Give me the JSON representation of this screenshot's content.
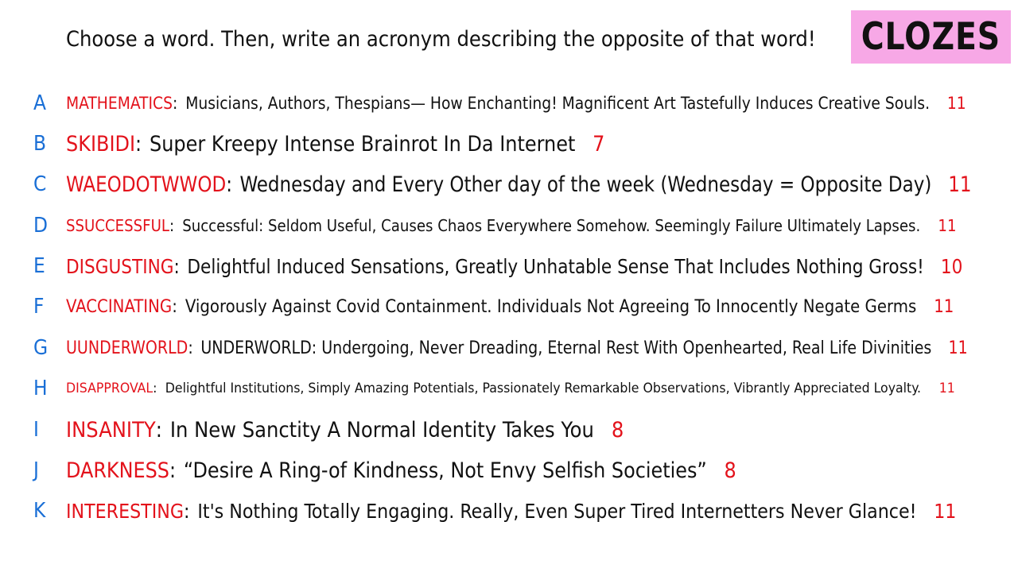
{
  "prompt": "Choose a word. Then, write an acronym describing the opposite of that word!",
  "badge": "CLOZES",
  "rows": [
    {
      "letter": "A",
      "word": "MATHEMATICS",
      "text": "Musicians, Authors, Thespians— How Enchanting! Magnificent Art Tastefully Induces Creative Souls.",
      "count": "11"
    },
    {
      "letter": "B",
      "word": "SKIBIDI",
      "text": "Super Kreepy Intense Brainrot In Da Internet",
      "count": "7"
    },
    {
      "letter": "C",
      "word": "WAEODOTWWOD",
      "text": "Wednesday and Every Other day of the week (Wednesday = Opposite Day)",
      "count": "11"
    },
    {
      "letter": "D",
      "word": "SSUCCESSFUL",
      "text": "Successful: Seldom Useful, Causes Chaos Everywhere Somehow. Seemingly Failure Ultimately Lapses.",
      "count": "11"
    },
    {
      "letter": "E",
      "word": "DISGUSTING",
      "text": "Delightful Induced Sensations, Greatly Unhatable Sense That Includes Nothing Gross!",
      "count": "10"
    },
    {
      "letter": "F",
      "word": "VACCINATING",
      "text": "Vigorously Against Covid Containment. Individuals Not Agreeing To Innocently Negate Germs",
      "count": "11"
    },
    {
      "letter": "G",
      "word": "UUNDERWORLD",
      "text": "UNDERWORLD: Undergoing, Never Dreading, Eternal Rest With Openhearted, Real Life Divinities",
      "count": "11"
    },
    {
      "letter": "H",
      "word": "DISAPPROVAL",
      "text": "Delightful Institutions, Simply Amazing Potentials, Passionately Remarkable Observations, Vibrantly Appreciated Loyalty.",
      "count": "11"
    },
    {
      "letter": "I",
      "word": "INSANITY",
      "text": "In New Sanctity A Normal Identity Takes You",
      "count": "8"
    },
    {
      "letter": "J",
      "word": "DARKNESS",
      "text": "“Desire A Ring-of Kindness, Not Envy Selfish Societies”",
      "count": "8"
    },
    {
      "letter": "K",
      "word": "INTERESTING",
      "text": "It's Nothing Totally Engaging. Really, Even Super Tired Internetters Never Glance!",
      "count": "11"
    }
  ]
}
